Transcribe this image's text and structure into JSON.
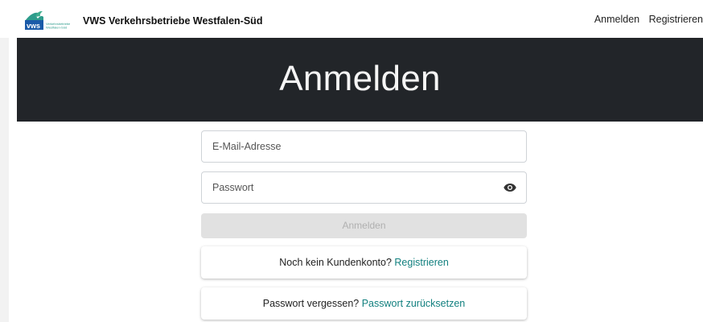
{
  "header": {
    "logo_text": "vws",
    "logo_subtext_1": "Verkehrsbetriebe",
    "logo_subtext_2": "Westfalen-Süd",
    "brand_name": "VWS Verkehrsbetriebe Westfalen-Süd",
    "nav": {
      "login": "Anmelden",
      "register": "Registrieren"
    }
  },
  "hero": {
    "title": "Anmelden"
  },
  "form": {
    "email_placeholder": "E-Mail-Adresse",
    "password_placeholder": "Passwort",
    "submit_label": "Anmelden"
  },
  "register_card": {
    "text": "Noch kein Kundenkonto? ",
    "link": "Registrieren"
  },
  "reset_card": {
    "text": "Passwort vergessen? ",
    "link": "Passwort zurücksetzen"
  },
  "colors": {
    "accent": "#12807f",
    "hero_bg": "#222529",
    "logo_green": "#2e9c8c",
    "logo_blue": "#1a5aa8"
  },
  "icons": {
    "password_toggle": "eye-icon"
  }
}
